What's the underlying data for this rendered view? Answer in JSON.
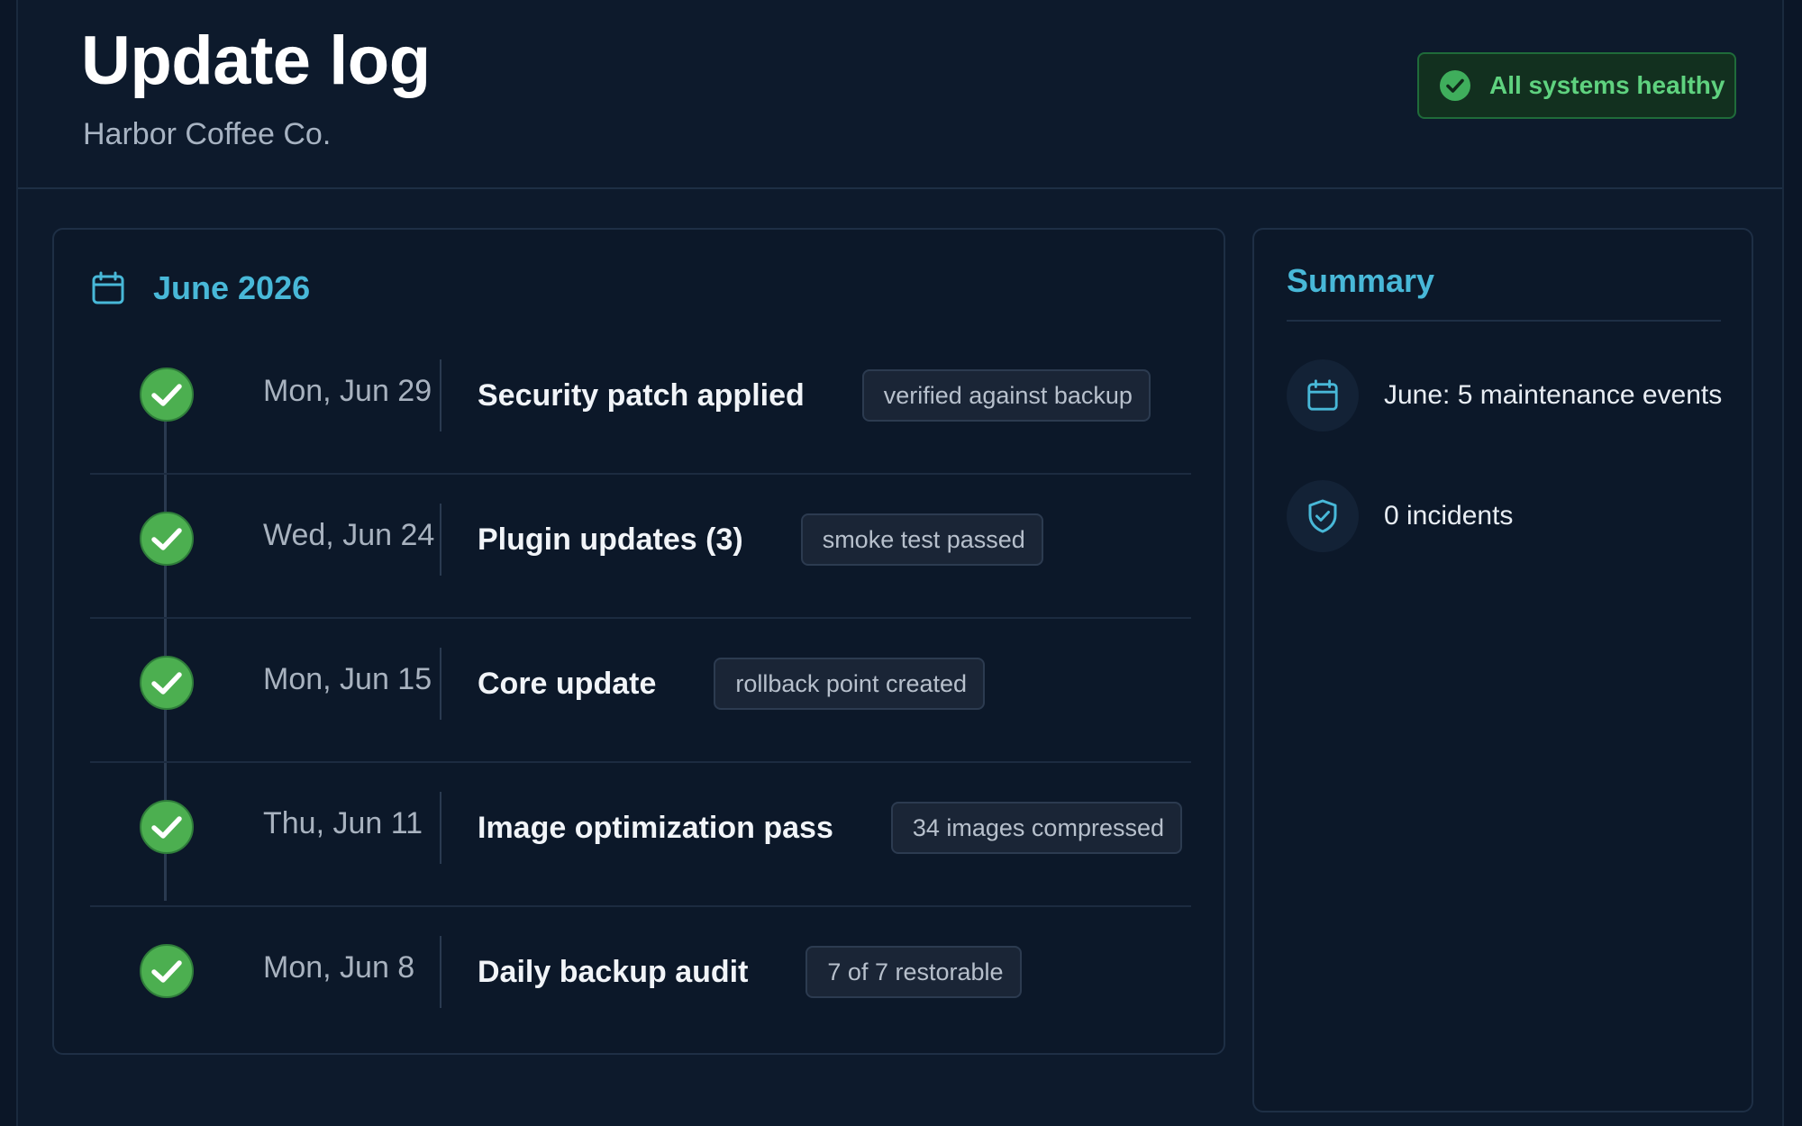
{
  "header": {
    "title": "Update log",
    "subtitle": "Harbor Coffee Co.",
    "status": "All systems healthy"
  },
  "log": {
    "month": "June 2026",
    "entries": [
      {
        "date": "Mon, Jun 29",
        "title": "Security patch applied",
        "badge": "verified against backup"
      },
      {
        "date": "Wed, Jun 24",
        "title": "Plugin updates (3)",
        "badge": "smoke test passed"
      },
      {
        "date": "Mon, Jun 15",
        "title": "Core update",
        "badge": "rollback point created"
      },
      {
        "date": "Thu, Jun 11",
        "title": "Image optimization pass",
        "badge": "34 images compressed"
      },
      {
        "date": "Mon, Jun 8",
        "title": "Daily backup audit",
        "badge": "7 of 7 restorable"
      }
    ]
  },
  "summary": {
    "title": "Summary",
    "events": "June: 5 maintenance events",
    "incidents": "0 incidents"
  },
  "icons": {
    "status": "check-circle-icon",
    "month": "calendar-icon",
    "entry": "check-circle-icon",
    "events": "calendar-icon",
    "incidents": "shield-check-icon"
  },
  "colors": {
    "accent": "#48b8d8",
    "success": "#4caf50",
    "success_text": "#5fd27f",
    "background": "#0d1a2c"
  }
}
